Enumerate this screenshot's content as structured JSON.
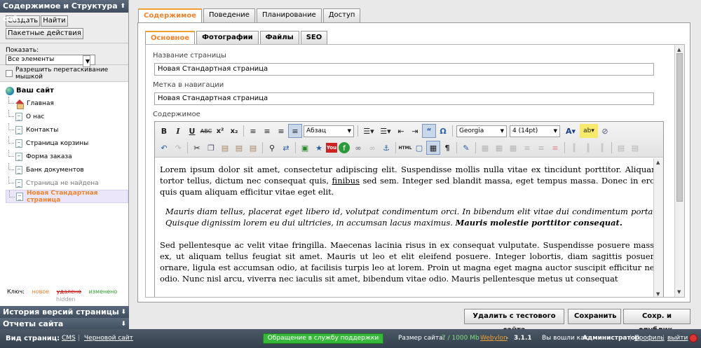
{
  "left": {
    "header": "Содержимое и Структура сайта",
    "buttons": {
      "create": "Создать",
      "find": "Найти",
      "batch": "Пакетные действия"
    },
    "show_label": "Показать:",
    "show_value": "Все элементы",
    "drag_label": "Разрешить перетаскивание мышкой",
    "tree_root": "Ваш сайт",
    "tree_items": [
      {
        "label": "Главная",
        "icon": "home-icon"
      },
      {
        "label": "О нас",
        "icon": "page-icon"
      },
      {
        "label": "Контакты",
        "icon": "page-icon"
      },
      {
        "label": "Страница корзины",
        "icon": "page-icon"
      },
      {
        "label": "Форма заказа",
        "icon": "page-icon"
      },
      {
        "label": "Банк документов",
        "icon": "page-icon"
      },
      {
        "label": "Страница не найдена",
        "icon": "page-icon"
      },
      {
        "label": "Новая Стандартная страница",
        "icon": "page-icon"
      }
    ],
    "key": {
      "label": "Ключ:",
      "new": "новое",
      "deleted": "удалено",
      "changed": "изменено",
      "hidden": "hidden"
    },
    "history": "История версий страницы",
    "reports": "Отчеты сайта"
  },
  "tabs_main": [
    "Содержимое",
    "Поведение",
    "Планирование",
    "Доступ"
  ],
  "tabs_sub": [
    "Основное",
    "Фотографии",
    "Файлы",
    "SEO"
  ],
  "fields": {
    "page_name_label": "Название страницы",
    "page_name_value": "Новая Стандартная страница",
    "nav_label": "Метка в навигации",
    "nav_value": "Новая Стандартная страница",
    "content_label": "Содержимое"
  },
  "editor": {
    "format_value": "Абзац",
    "font_value": "Georgia",
    "size_value": "4 (14pt)",
    "para1_a": "Lorem ipsum dolor sit amet, consectetur adipiscing elit. Suspendisse mollis nulla vitae ex tincidunt porttitor. Aliquam tortor tellus, dictum nec consequat quis, ",
    "para1_link": "finibus",
    "para1_b": " sed sem. Integer sed blandit massa, eget tempus massa. Donec in eros quis quam aliquam efficitur vitae eget elit.",
    "quote_a": "Mauris diam tellus, placerat eget libero id, volutpat condimentum orci. In bibendum elit vitae dui condimentum porta. Quisque dignissim lorem eu dui ultricies, in accumsan lacus maximus. ",
    "quote_bold": "Mauris molestie porttitor consequat.",
    "para2": "Sed pellentesque ac velit vitae fringilla. Maecenas lacinia risus in ex consequat vulputate. Suspendisse posuere massa ex, ut aliquam tellus feugiat sit amet. Mauris ut leo et elit eleifend posuere. Integer lobortis, diam sagittis posuere ornare, ligula est accumsan odio, at facilisis turpis leo at lorem. Proin ut magna eget magna auctor suscipit efficitur nec odio. Nunc nisl arcu, viverra nec iaculis sit amet, bibendum vitae odio. Mauris pellentesque metus ut consequat"
  },
  "actions": {
    "remove": "Удалить с тестового сайта",
    "save": "Сохранить",
    "save_publish": "Сохр. и опублик."
  },
  "status": {
    "view_label": "Вид страниц:",
    "cms": "CMS",
    "draft": "Черновой сайт",
    "support": "Обращение в службу поддержки",
    "size_label": "Размер сайта:",
    "size_value": "7 / 1000 Mb",
    "brand": "Webylon",
    "version": "3.1.1",
    "logged_prefix": "Вы вошли как",
    "user": "Администратор",
    "profile": "Профиль",
    "logout": "выйти"
  }
}
